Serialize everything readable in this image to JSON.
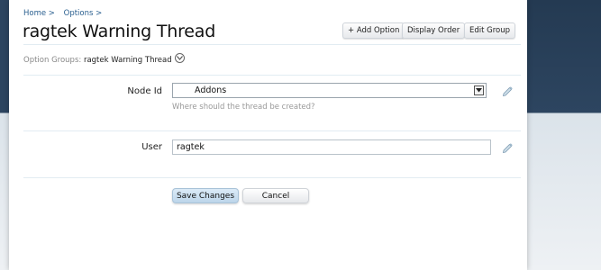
{
  "breadcrumb": {
    "home": "Home >",
    "options": "Options >"
  },
  "page_title": "ragtek Warning Thread",
  "toolbar": {
    "add_option": "+ Add Option",
    "display_order": "Display Order",
    "edit_group": "Edit Group"
  },
  "option_groups": {
    "label": "Option Groups:",
    "value": "ragtek Warning Thread"
  },
  "fields": {
    "node_id": {
      "label": "Node Id",
      "selected": "Addons",
      "hint": "Where should the thread be created?"
    },
    "user": {
      "label": "User",
      "value": "ragtek"
    }
  },
  "actions": {
    "save": "Save Changes",
    "cancel": "Cancel"
  },
  "icons": {
    "edit": "pencil-edit-icon",
    "dropdown": "chevron-down-icon",
    "group_menu": "circle-chevron-down-icon"
  },
  "colors": {
    "link": "#2a5f8f",
    "primary_button": "#bcd5ea",
    "header_background": "#2d4560"
  }
}
